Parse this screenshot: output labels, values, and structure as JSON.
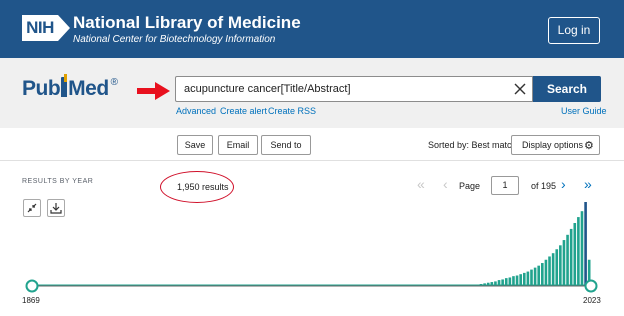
{
  "header": {
    "org_badge": "NIH",
    "title": "National Library of Medicine",
    "subtitle": "National Center for Biotechnology Information",
    "login_label": "Log in"
  },
  "search": {
    "logo_left": "Pub",
    "logo_right": "Med",
    "logo_mark": "®",
    "query": "acupuncture cancer[Title/Abstract]",
    "button_label": "Search",
    "links": [
      "Advanced",
      "Create alert",
      "Create RSS"
    ],
    "user_guide": "User Guide"
  },
  "toolbar": {
    "save": "Save",
    "email": "Email",
    "send_to": "Send to",
    "sorted_by": "Sorted by: Best match",
    "display_options": "Display options"
  },
  "results": {
    "section_label": "RESULTS BY YEAR",
    "count_text": "1,950 results",
    "page_label": "Page",
    "page_value": "1",
    "page_total": "of 195"
  },
  "chart_data": {
    "type": "bar",
    "x_start": "1869",
    "x_end": "2023",
    "recent_values": [
      3,
      4,
      5,
      6,
      7,
      9,
      10,
      12,
      13,
      15,
      16,
      18,
      20,
      22,
      25,
      28,
      31,
      35,
      40,
      45,
      50,
      56,
      62,
      70,
      78,
      87,
      96,
      105,
      114,
      128,
      40
    ],
    "colors": {
      "bar": "#21a38e",
      "highlight": "#20558a"
    }
  },
  "colors": {
    "brand": "#20558a",
    "link": "#0071bc",
    "annotation": "#d0102a"
  }
}
